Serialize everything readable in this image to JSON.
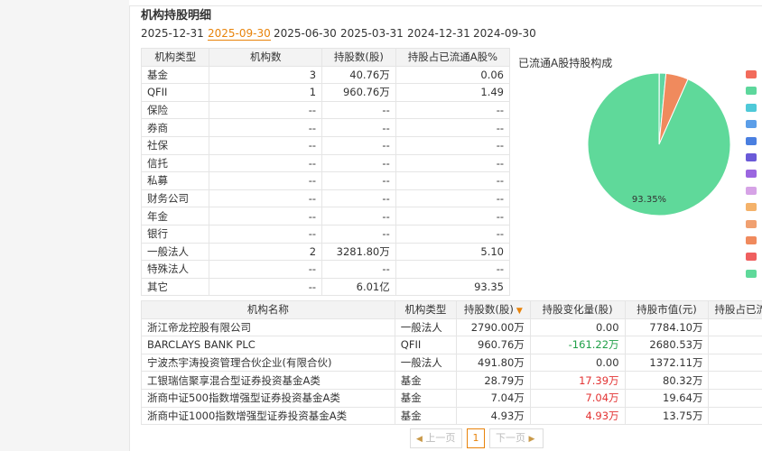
{
  "top_tabs": [
    "...",
    "...",
    "...",
    "...",
    "..."
  ],
  "title": "机构持股明细",
  "dates": [
    "2025-12-31",
    "2025-09-30",
    "2025-06-30",
    "2025-03-31",
    "2024-12-31",
    "2024-09-30"
  ],
  "active_date": "2025-09-30",
  "summary": {
    "headers": [
      "机构类型",
      "机构数",
      "持股数(股)",
      "持股占已流通A股%"
    ],
    "rows": [
      [
        "基金",
        "3",
        "40.76万",
        "0.06"
      ],
      [
        "QFII",
        "1",
        "960.76万",
        "1.49"
      ],
      [
        "保险",
        "--",
        "--",
        "--"
      ],
      [
        "券商",
        "--",
        "--",
        "--"
      ],
      [
        "社保",
        "--",
        "--",
        "--"
      ],
      [
        "信托",
        "--",
        "--",
        "--"
      ],
      [
        "私募",
        "--",
        "--",
        "--"
      ],
      [
        "财务公司",
        "--",
        "--",
        "--"
      ],
      [
        "年金",
        "--",
        "--",
        "--"
      ],
      [
        "银行",
        "--",
        "--",
        "--"
      ],
      [
        "一般法人",
        "2",
        "3281.80万",
        "5.10"
      ],
      [
        "特殊法人",
        "--",
        "--",
        "--"
      ],
      [
        "其它",
        "--",
        "6.01亿",
        "93.35"
      ]
    ]
  },
  "detail": {
    "headers": [
      "机构名称",
      "机构类型",
      "持股数(股)",
      "持股变化量(股)",
      "持股市值(元)",
      "持股占已流"
    ],
    "rows": [
      [
        "浙江帝龙控股有限公司",
        "一般法人",
        "2790.00万",
        "0.00",
        "7784.10万"
      ],
      [
        "BARCLAYS BANK PLC",
        "QFII",
        "960.76万",
        "-161.22万",
        "2680.53万"
      ],
      [
        "宁波杰宇涛投资管理合伙企业(有限合伙)",
        "一般法人",
        "491.80万",
        "0.00",
        "1372.11万"
      ],
      [
        "工银瑞信聚享混合型证券投资基金A类",
        "基金",
        "28.79万",
        "17.39万",
        "80.32万"
      ],
      [
        "浙商中证500指数增强型证券投资基金A类",
        "基金",
        "7.04万",
        "7.04万",
        "19.64万"
      ],
      [
        "浙商中证1000指数增强型证券投资基金A类",
        "基金",
        "4.93万",
        "4.93万",
        "13.75万"
      ]
    ],
    "change_colors": [
      "none",
      "green",
      "none",
      "red",
      "red",
      "red"
    ]
  },
  "pie": {
    "title": "已流通A股持股构成",
    "label": "93.35%"
  },
  "chart_data": {
    "type": "pie",
    "title": "已流通A股持股构成",
    "slices": [
      {
        "value": 0.06,
        "color": "#ef6c5a"
      },
      {
        "value": 1.49,
        "color": "#60d6a2"
      },
      {
        "value": 5.1,
        "color": "#f08a5d"
      },
      {
        "value": 93.35,
        "color": "#5fd99a"
      }
    ],
    "data_labels": [
      "93.35%"
    ],
    "legend_colors": [
      "#f26b5b",
      "#5dd79c",
      "#4fc9d8",
      "#5b9ee8",
      "#4a7fe0",
      "#6a5ad8",
      "#9b66e0",
      "#d6a3e6",
      "#f4b26a",
      "#f0a070",
      "#f08a5d",
      "#ef5f5f",
      "#5fd99a"
    ]
  },
  "pager": {
    "prev": "上一页",
    "page": "1",
    "next": "下一页"
  }
}
